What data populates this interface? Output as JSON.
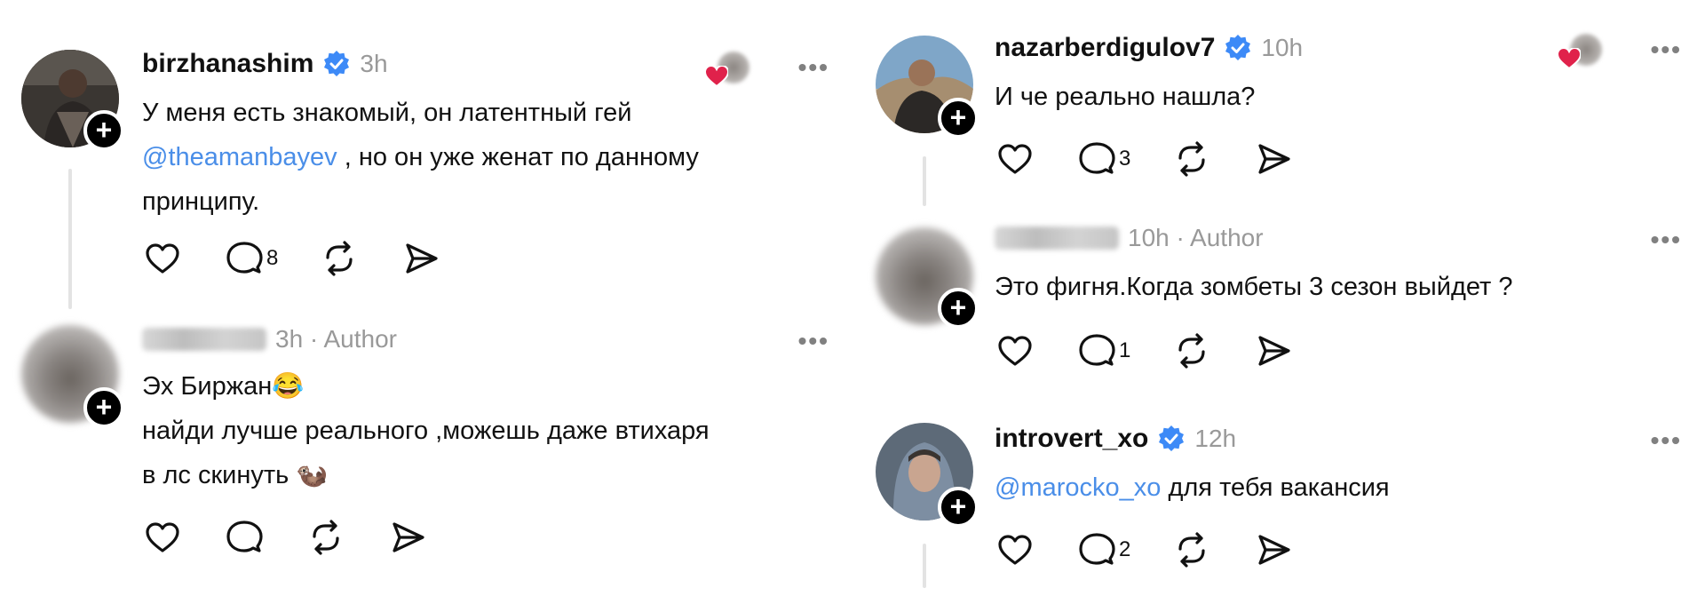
{
  "colors": {
    "accent": "#4a8ee8",
    "verified": "#3d8af7",
    "heart": "#e0224b",
    "muted": "#999999"
  },
  "posts": [
    {
      "username": "birzhanashim",
      "verified": true,
      "time": "3h",
      "liked_by_author": true,
      "lines": [
        [
          {
            "t": "У меня есть знакомый, он латентный гей"
          }
        ],
        [
          {
            "t": "@theamanbayev",
            "mention": true
          },
          {
            "t": " , но он уже женат по данному"
          }
        ],
        [
          {
            "t": "принципу."
          }
        ]
      ],
      "replies": "8"
    },
    {
      "username": "arcasadel",
      "username_blurred": true,
      "time": "3h · Author",
      "lines": [
        [
          {
            "t": "Эх Биржан😂"
          }
        ],
        [
          {
            "t": "найди лучше реального ,можешь даже втихаря"
          }
        ],
        [
          {
            "t": "в лс скинуть 🦦"
          }
        ]
      ],
      "replies": ""
    },
    {
      "username": "nazarberdigulov7",
      "verified": true,
      "time": "10h",
      "liked_by_author": true,
      "lines": [
        [
          {
            "t": "И че реально нашла?"
          }
        ]
      ],
      "replies": "3"
    },
    {
      "username": "arcasadel",
      "username_blurred": true,
      "time": "10h · Author",
      "lines": [
        [
          {
            "t": "Это фигня.Когда зомбеты 3 сезон выйдет ?"
          }
        ]
      ],
      "replies": "1"
    },
    {
      "username": "introvert_xo",
      "verified": true,
      "time": "12h",
      "lines": [
        [
          {
            "t": "@marocko_xo",
            "mention": true
          },
          {
            "t": " для тебя вакансия"
          }
        ]
      ],
      "replies": "2"
    }
  ],
  "icons": {
    "like": "heart-outline-icon",
    "reply": "speech-bubble-icon",
    "repost": "repost-arrows-icon",
    "share": "paper-plane-icon",
    "more": "more-dots-icon",
    "follow": "plus-icon",
    "verified": "verified-badge-icon"
  },
  "more_label": "•••",
  "plus_label": "+"
}
